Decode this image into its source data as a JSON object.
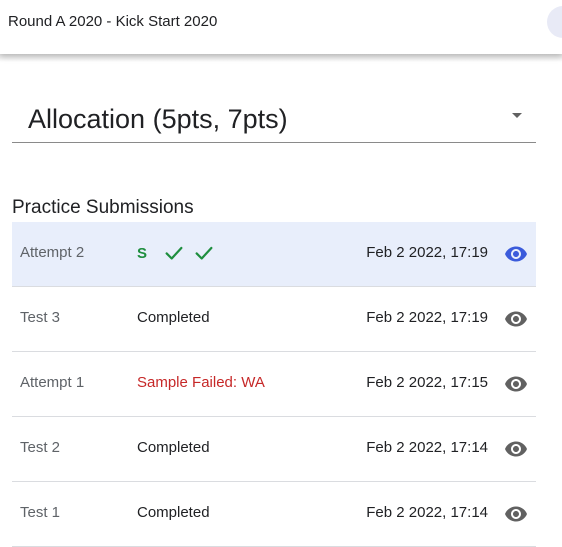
{
  "header": {
    "title": "Round A 2020 - Kick Start 2020"
  },
  "problem_select": {
    "value": "Allocation (5pts, 7pts)",
    "icon": "dropdown-caret-icon"
  },
  "practice": {
    "title": "Practice Submissions",
    "rows": [
      {
        "name": "Attempt 2",
        "status": "",
        "verdicts": [
          "S",
          "check",
          "check"
        ],
        "date": "Feb 2 2022, 17:19",
        "selected": true,
        "eye_color": "#3b5bdb"
      },
      {
        "name": "Test 3",
        "status": "Completed",
        "date": "Feb 2 2022, 17:19",
        "selected": false,
        "eye_color": "#616161"
      },
      {
        "name": "Attempt 1",
        "status": "Sample Failed: WA",
        "status_type": "fail",
        "date": "Feb 2 2022, 17:15",
        "selected": false,
        "eye_color": "#616161"
      },
      {
        "name": "Test 2",
        "status": "Completed",
        "date": "Feb 2 2022, 17:14",
        "selected": false,
        "eye_color": "#616161"
      },
      {
        "name": "Test 1",
        "status": "Completed",
        "date": "Feb 2 2022, 17:14",
        "selected": false,
        "eye_color": "#616161"
      }
    ]
  },
  "colors": {
    "pass_green": "#1e8e3e",
    "fail_red": "#c62828",
    "selected_row": "#e8eefb"
  }
}
